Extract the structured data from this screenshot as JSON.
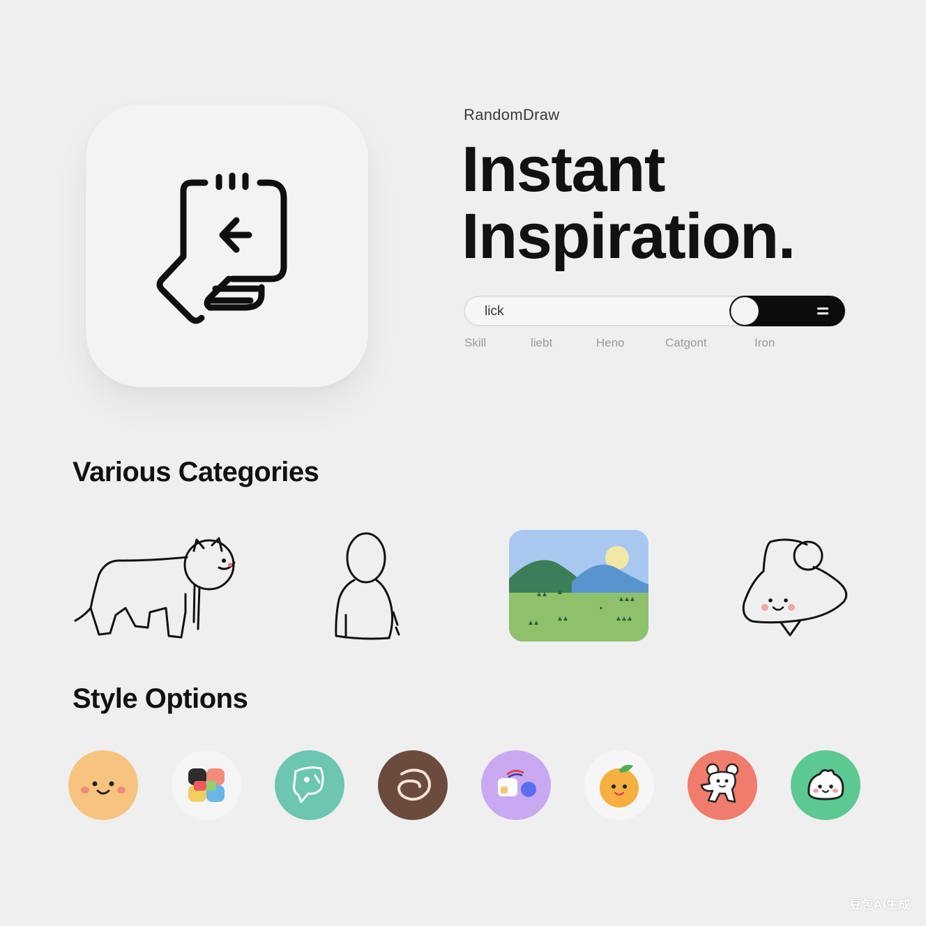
{
  "brand": {
    "name": "RandomDraw"
  },
  "hero": {
    "title_line1": "Instant",
    "title_line2": "Inspiration."
  },
  "search": {
    "value": "lick"
  },
  "filters": [
    "Skill",
    "liebt",
    "Heno",
    "Catgont",
    "Iron"
  ],
  "sections": {
    "categories_title": "Various Categories",
    "styles_title": "Style Options"
  },
  "categories": [
    "animal-icon",
    "person-icon",
    "landscape-icon",
    "character-icon"
  ],
  "style_options": [
    {
      "icon": "smiley-face-icon",
      "color": "#f7c47f"
    },
    {
      "icon": "color-blocks-icon",
      "color": "#f5f5f5"
    },
    {
      "icon": "sketch-face-icon",
      "color": "#6cc6b1"
    },
    {
      "icon": "spiral-icon",
      "color": "#6b4b3e"
    },
    {
      "icon": "shapes-icon",
      "color": "#c8a9f1"
    },
    {
      "icon": "orange-fruit-icon",
      "color": "#f6f6f6"
    },
    {
      "icon": "mouse-character-icon",
      "color": "#f07c6b"
    },
    {
      "icon": "cute-bun-icon",
      "color": "#5cc892"
    }
  ],
  "watermark": "豆包AI生成"
}
